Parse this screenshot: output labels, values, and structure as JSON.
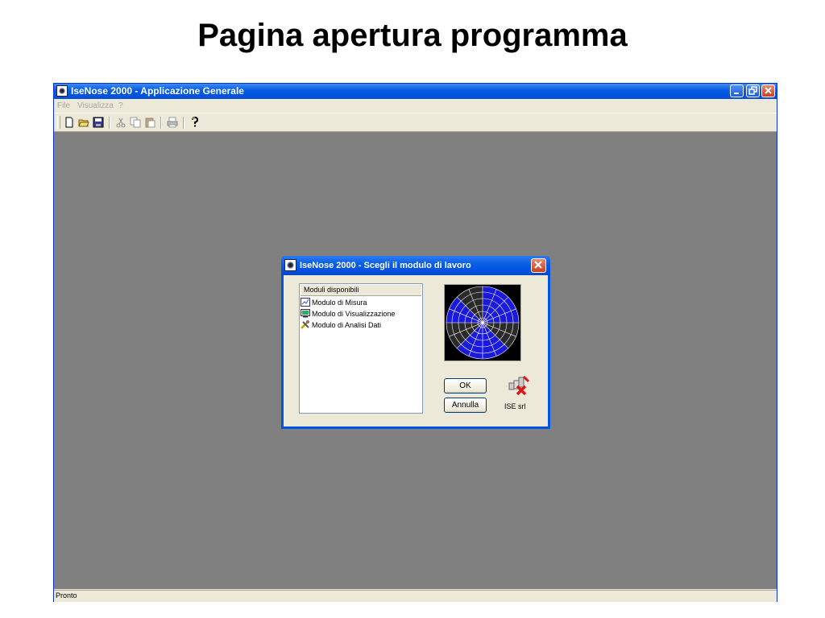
{
  "slide_title": "Pagina apertura programma",
  "app": {
    "title": "IseNose 2000 - Applicazione Generale",
    "menu": [
      "File",
      "Visualizza",
      "?"
    ],
    "toolbar_icons": [
      "new-file-icon",
      "open-folder-icon",
      "save-icon",
      "cut-icon",
      "copy-icon",
      "paste-icon",
      "print-icon",
      "help-icon"
    ],
    "status": "Pronto"
  },
  "dialog": {
    "title": "IseNose 2000 - Scegli il modulo di lavoro",
    "list_header": "Moduli disponibili",
    "items": [
      {
        "label": "Modulo di Misura",
        "icon": "chart-icon"
      },
      {
        "label": "Modulo di Visualizzazione",
        "icon": "monitor-icon"
      },
      {
        "label": "Modulo di Analisi Dati",
        "icon": "tools-icon"
      }
    ],
    "ok_label": "OK",
    "cancel_label": "Annulla",
    "logo_label": "ISE srl"
  },
  "colors": {
    "titlebar_blue": "#0054e3",
    "mdi_background": "#808080",
    "radar_blue": "#1a1adc",
    "close_red": "#c8401e"
  }
}
